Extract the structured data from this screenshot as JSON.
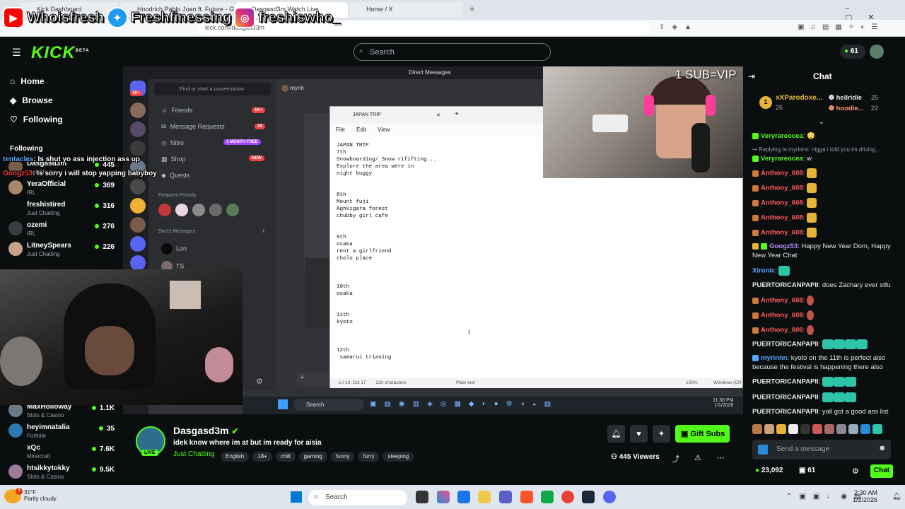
{
  "browser": {
    "tabs": [
      "Kick Dashboard",
      "Hoodrich Pablo Juan ft. Future - Good On Lo...",
      "Dasgasd3m Watch Live",
      "Home / X"
    ],
    "url": "kick.com/dasgasd3m"
  },
  "overlay_socials": {
    "youtube": "Whoisfresh",
    "twitter": "Freshfinessing",
    "instagram": "freshiswho_"
  },
  "kick": {
    "logo": "KICK",
    "logo_sup": "BETA",
    "search_placeholder": "Search",
    "points": "61"
  },
  "sidebar": {
    "nav": [
      {
        "label": "Home",
        "icon": "home-icon"
      },
      {
        "label": "Browse",
        "icon": "compass-icon"
      },
      {
        "label": "Following",
        "icon": "heart-icon"
      }
    ],
    "following_title": "Following",
    "following": [
      {
        "name": "Dasgasd3m",
        "category": "Just Chatting",
        "viewers": "445"
      },
      {
        "name": "YeraOfficial",
        "category": "IRL",
        "viewers": "369"
      },
      {
        "name": "freshistired",
        "category": "Just Chatting",
        "viewers": "316"
      },
      {
        "name": "ozemi",
        "category": "IRL",
        "viewers": "276"
      },
      {
        "name": "LitneySpears",
        "category": "Just Chatting",
        "viewers": "226"
      }
    ],
    "recommended": [
      {
        "name": "MaxHolloway",
        "category": "Slots & Casino",
        "viewers": "1.1K"
      },
      {
        "name": "heyimnatalia",
        "category": "Fortnite",
        "viewers": "35"
      },
      {
        "name": "xQc",
        "category": "Minecraft",
        "viewers": "7.6K"
      },
      {
        "name": "htsikkytokky",
        "category": "Slots & Casino",
        "viewers": "9.5K"
      }
    ]
  },
  "overlay_chat": [
    {
      "user": "tentacles",
      "text": ": Is shut yo ass injection ass up"
    },
    {
      "user": "Googz53",
      "text": ": Is sorry i will stop yapping babyboy"
    }
  ],
  "video": {
    "sub_banner": "1 SUB=VIP",
    "discord": {
      "header": "Direct Messages",
      "find": "Find or start a conversation",
      "dm_user": "myrin",
      "items": [
        {
          "label": "Friends",
          "badge": "1K+"
        },
        {
          "label": "Message Requests",
          "badge": "18"
        },
        {
          "label": "Nitro",
          "badge": "1 MONTH FREE"
        },
        {
          "label": "Shop",
          "badge": "NEW"
        },
        {
          "label": "Quests",
          "badge": ""
        }
      ],
      "frequent": "Frequent Friends",
      "dm_title": "Direct Messages",
      "dms": [
        "Lon",
        "TS"
      ],
      "left_pill": "1K+"
    },
    "notepad": {
      "tab": "JAPAN TRIP",
      "menu": [
        "File",
        "Edit",
        "View"
      ],
      "content": "JAPAN TRIP\n7th\nSnowboarding/ Snow rififting...\nExplore the area were in\nnight buggy\n\n\n8th\nMount fuji\nAghkigara forest\nchubby girl cafe\n\n\n9th\nosaka\nrent a girlfriend\ncholo place\n\n\n\n10th\nosaka\n\n\n11th\nkyoto\n\n\n\n12th\n samarui trianing",
      "status": [
        "Ln 10, Col 17",
        "230 characters",
        "Plain text",
        "100%",
        "Windows (CR"
      ]
    },
    "inner_taskbar": {
      "search": "Search",
      "time": "11:30 PM",
      "date": "1/1/2026"
    }
  },
  "chat": {
    "title": "Chat",
    "gifters": [
      {
        "rank": "1",
        "name": "xXParodoxe...",
        "count": "26"
      },
      {
        "name": "hellridle",
        "count": "25"
      },
      {
        "name": "hoodie...",
        "count": "22"
      }
    ],
    "messages": [
      {
        "user": "Veryrareocea",
        "color": "#53fc18",
        "text": ": 😳"
      },
      {
        "reply": "Replying to myrinnn: nigga i told you im driving..."
      },
      {
        "user": "Veryrareocea",
        "color": "#53fc18",
        "text": ": w"
      },
      {
        "user": "Anthony_608",
        "color": "#ff5b5b",
        "text": ":",
        "emote": "gold"
      },
      {
        "user": "Anthony_608",
        "color": "#ff5b5b",
        "text": ":",
        "emote": "gold"
      },
      {
        "user": "Anthony_608",
        "color": "#ff5b5b",
        "text": ":",
        "emote": "gold"
      },
      {
        "user": "Anthony_608",
        "color": "#ff5b5b",
        "text": ":",
        "emote": "gold"
      },
      {
        "user": "Anthony_608",
        "color": "#ff5b5b",
        "text": ":",
        "emote": "gold"
      },
      {
        "user": "Googz53",
        "color": "#b98cff",
        "text": ": Happy New Year Dom, Happy New Year Chat"
      },
      {
        "user": "Xironic",
        "color": "#59a8ff",
        "text": ":",
        "emote": "teal"
      },
      {
        "user": "PUERTORICANPAPII",
        "color": "#ffffff",
        "text": ": does Zachary ever stfu"
      },
      {
        "user": "Anthony_608",
        "color": "#ff5b5b",
        "text": ":",
        "emote": "red"
      },
      {
        "user": "Anthony_608",
        "color": "#ff5b5b",
        "text": ":",
        "emote": "red"
      },
      {
        "user": "Anthony_606",
        "color": "#ff5b5b",
        "text": ":",
        "emote": "red"
      },
      {
        "user": "PUERTORICANPAPII",
        "color": "#ffffff",
        "text": ":",
        "emote": "teal4"
      },
      {
        "user": "myrinnn",
        "color": "#59a8ff",
        "text": ": kyoto on the 11th is perfect also because the festival is happening there also"
      },
      {
        "user": "PUERTORICANPAPII",
        "color": "#ffffff",
        "text": ":",
        "emote": "teal3"
      },
      {
        "user": "PUERTORICANPAPII",
        "color": "#ffffff",
        "text": ":",
        "emote": "teal3"
      },
      {
        "user": "PUERTORICANPAPII",
        "color": "#ffffff",
        "text": ": yall got a good ass list"
      }
    ],
    "input_placeholder": "Send a message",
    "points": "23,092",
    "subs": "61",
    "send_label": "Chat"
  },
  "stream": {
    "name": "Dasgasd3m",
    "title": "idek know where im at but im ready for aisia",
    "category": "Just Chatting",
    "tags": [
      "English",
      "18+",
      "chill",
      "gaming",
      "funny",
      "furry",
      "sleeping"
    ],
    "live_label": "LIVE",
    "gift_label": "Gift Subs",
    "viewers": "445 Viewers"
  },
  "windows": {
    "weather_temp": "31°F",
    "weather_desc": "Partly cloudy",
    "search": "Search",
    "time": "2:30 AM",
    "date": "1/2/2026",
    "badge_count": "3"
  },
  "colors": {
    "kick_green": "#53fc18",
    "discord_blurple": "#5865f2",
    "live_red": "#f23f43"
  }
}
